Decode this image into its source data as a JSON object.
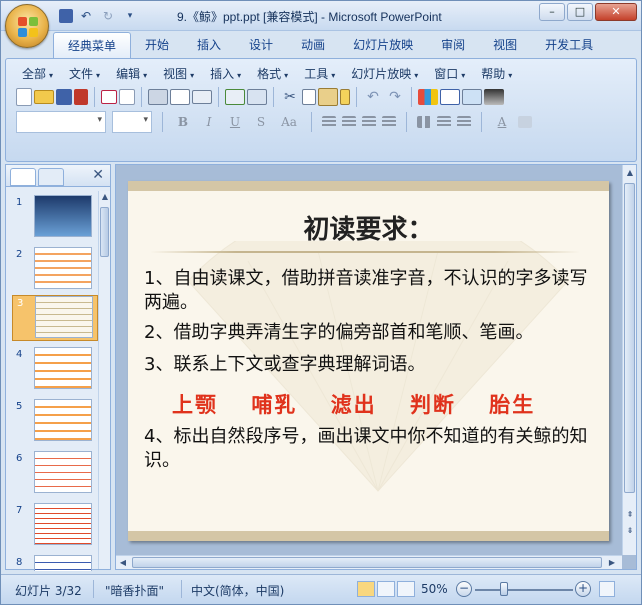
{
  "window": {
    "title": "9.《鲸》ppt.ppt [兼容模式] - Microsoft PowerPoint",
    "controls": [
      "–",
      "□",
      "✕"
    ]
  },
  "ribbon_tabs": [
    {
      "label": "经典菜单",
      "active": true
    },
    {
      "label": "开始"
    },
    {
      "label": "插入"
    },
    {
      "label": "设计"
    },
    {
      "label": "动画"
    },
    {
      "label": "幻灯片放映"
    },
    {
      "label": "审阅"
    },
    {
      "label": "视图"
    },
    {
      "label": "开发工具"
    }
  ],
  "menus": [
    "全部",
    "文件",
    "编辑",
    "视图",
    "插入",
    "格式",
    "工具",
    "幻灯片放映",
    "窗口",
    "帮助"
  ],
  "format_buttons": [
    "B",
    "I",
    "U",
    "S",
    "Aa"
  ],
  "thumbnails": [
    {
      "num": "1"
    },
    {
      "num": "2"
    },
    {
      "num": "3",
      "selected": true
    },
    {
      "num": "4"
    },
    {
      "num": "5"
    },
    {
      "num": "6"
    },
    {
      "num": "7"
    },
    {
      "num": "8"
    }
  ],
  "slide": {
    "title": "初读要求：",
    "items": [
      "1、自由读课文，借助拼音读准字音，不认识的字多读写两遍。",
      "2、借助字典弄清生字的偏旁部首和笔顺、笔画。",
      "3、联系上下文或查字典理解词语。",
      "4、标出自然段序号，画出课文中你不知道的有关鲸的知识。"
    ],
    "keywords": [
      "上颚",
      "哺乳",
      "滤出",
      "判断",
      "胎生"
    ]
  },
  "statusbar": {
    "slide_info": "幻灯片 3/32",
    "theme": "\"暗香扑面\"",
    "language": "中文(简体，中国)",
    "zoom": "50%",
    "zoom_level": 0.3
  },
  "colors": {
    "accent": "#15428b",
    "keyword": "#e0321c",
    "selected_thumb": "#f6c36b"
  }
}
